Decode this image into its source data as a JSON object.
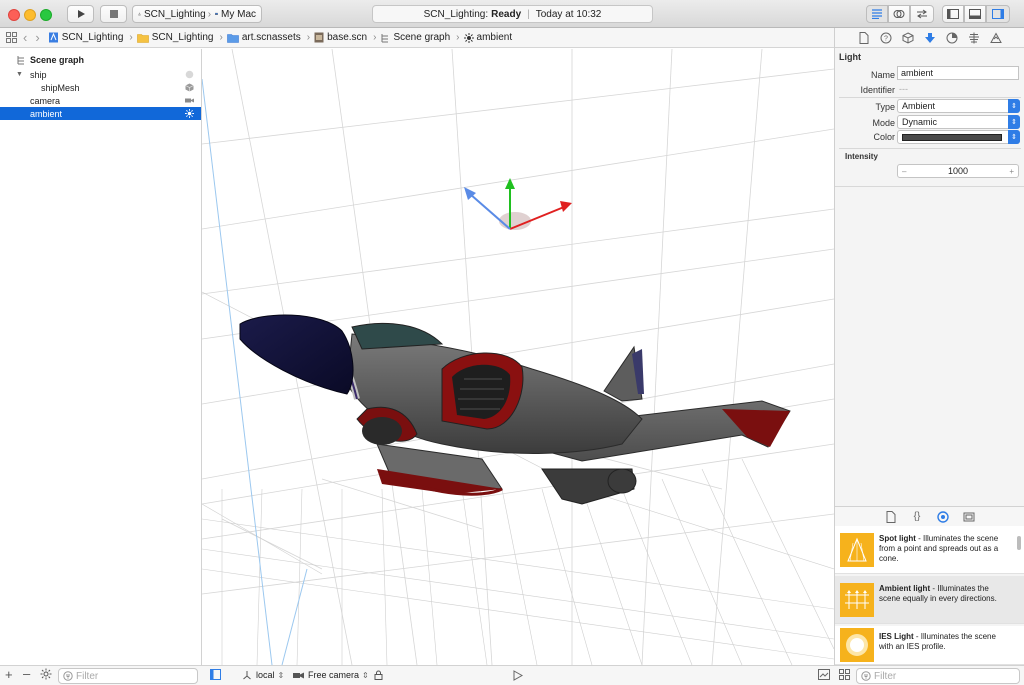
{
  "toolbar": {
    "scheme_target": "SCN_Lighting",
    "scheme_device": "My Mac",
    "status_project": "SCN_Lighting:",
    "status_state": "Ready",
    "status_time": "Today at 10:32"
  },
  "jumpbar": {
    "crumbs": [
      "SCN_Lighting",
      "SCN_Lighting",
      "art.scnassets",
      "base.scn",
      "Scene graph",
      "ambient"
    ]
  },
  "outline": {
    "header": "Scene graph",
    "items": [
      {
        "label": "ship",
        "icon": "node-icon"
      },
      {
        "label": "shipMesh",
        "icon": "geometry-icon"
      },
      {
        "label": "camera",
        "icon": "camera-icon"
      },
      {
        "label": "ambient",
        "icon": "light-icon"
      }
    ],
    "filter_placeholder": "Filter"
  },
  "viewport_bar": {
    "coord_space": "local",
    "camera": "Free camera"
  },
  "inspector": {
    "section": "Light",
    "name_label": "Name",
    "name_value": "ambient",
    "identifier_label": "Identifier",
    "identifier_value": "---",
    "type_label": "Type",
    "type_value": "Ambient",
    "mode_label": "Mode",
    "mode_value": "Dynamic",
    "color_label": "Color",
    "color_value": "#4a4a4a",
    "intensity_label": "Intensity",
    "intensity_value": "1000",
    "intensity_minus": "–",
    "intensity_plus": "+"
  },
  "library": {
    "items": [
      {
        "title": "Spot light",
        "desc": " - Illuminates the scene from a point and spreads out as a cone."
      },
      {
        "title": "Ambient light",
        "desc": " - Illuminates the scene equally in every directions."
      },
      {
        "title": "IES Light",
        "desc": " - Illuminates the scene with an IES profile."
      }
    ],
    "filter_placeholder": "Filter"
  },
  "colors": {
    "selection": "#1168d9",
    "accent": "#2f7de6",
    "library_icon": "#f6b21c"
  }
}
